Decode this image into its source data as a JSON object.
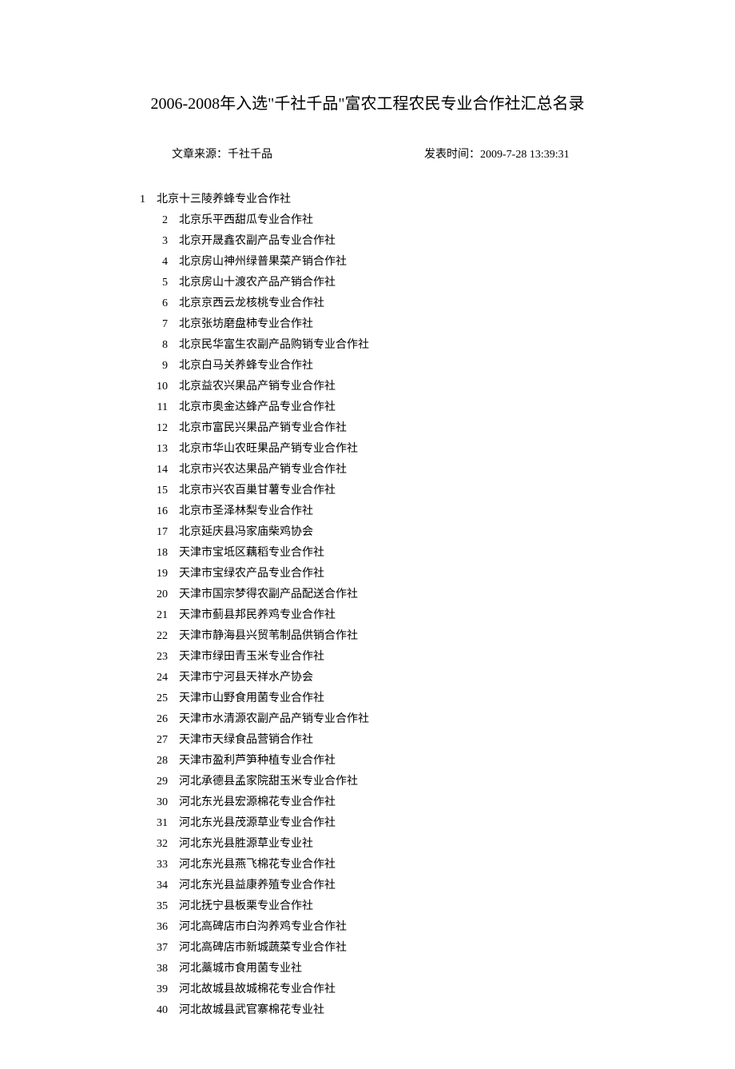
{
  "title": "2006-2008年入选\"千社千品\"富农工程农民专业合作社汇总名录",
  "source_label": "文章来源：千社千品",
  "publish_label": "发表时间：2009-7-28 13:39:31",
  "items": [
    {
      "n": "1",
      "name": "北京十三陵养蜂专业合作社"
    },
    {
      "n": "2",
      "name": "北京乐平西甜瓜专业合作社"
    },
    {
      "n": "3",
      "name": "北京开晟鑫农副产品专业合作社"
    },
    {
      "n": "4",
      "name": "北京房山神州绿普果菜产销合作社"
    },
    {
      "n": "5",
      "name": "北京房山十渡农产品产销合作社"
    },
    {
      "n": "6",
      "name": "北京京西云龙核桃专业合作社"
    },
    {
      "n": "7",
      "name": "北京张坊磨盘柿专业合作社"
    },
    {
      "n": "8",
      "name": "北京民华富生农副产品购销专业合作社"
    },
    {
      "n": "9",
      "name": "北京白马关养蜂专业合作社"
    },
    {
      "n": "10",
      "name": "北京益农兴果品产销专业合作社"
    },
    {
      "n": "11",
      "name": "北京市奥金达蜂产品专业合作社"
    },
    {
      "n": "12",
      "name": "北京市富民兴果品产销专业合作社"
    },
    {
      "n": "13",
      "name": "北京市华山农旺果品产销专业合作社"
    },
    {
      "n": "14",
      "name": "北京市兴农达果品产销专业合作社"
    },
    {
      "n": "15",
      "name": "北京市兴农百巢甘薯专业合作社"
    },
    {
      "n": "16",
      "name": "北京市圣泽林梨专业合作社"
    },
    {
      "n": "17",
      "name": "北京延庆县冯家庙柴鸡协会"
    },
    {
      "n": "18",
      "name": "天津市宝坻区藕稻专业合作社"
    },
    {
      "n": "19",
      "name": "天津市宝绿农产品专业合作社"
    },
    {
      "n": "20",
      "name": "天津市国宗梦得农副产品配送合作社"
    },
    {
      "n": "21",
      "name": "天津市蓟县邦民养鸡专业合作社"
    },
    {
      "n": "22",
      "name": "天津市静海县兴贸苇制品供销合作社"
    },
    {
      "n": "23",
      "name": "天津市绿田青玉米专业合作社"
    },
    {
      "n": "24",
      "name": "天津市宁河县天祥水产协会"
    },
    {
      "n": "25",
      "name": "天津市山野食用菌专业合作社"
    },
    {
      "n": "26",
      "name": "天津市水清源农副产品产销专业合作社"
    },
    {
      "n": "27",
      "name": "天津市天绿食品营销合作社"
    },
    {
      "n": "28",
      "name": "天津市盈利芦笋种植专业合作社"
    },
    {
      "n": "29",
      "name": "河北承德县孟家院甜玉米专业合作社"
    },
    {
      "n": "30",
      "name": "河北东光县宏源棉花专业合作社"
    },
    {
      "n": "31",
      "name": "河北东光县茂源草业专业合作社"
    },
    {
      "n": "32",
      "name": "河北东光县胜源草业专业社"
    },
    {
      "n": "33",
      "name": "河北东光县燕飞棉花专业合作社"
    },
    {
      "n": "34",
      "name": "河北东光县益康养殖专业合作社"
    },
    {
      "n": "35",
      "name": "河北抚宁县板栗专业合作社"
    },
    {
      "n": "36",
      "name": "河北高碑店市白沟养鸡专业合作社"
    },
    {
      "n": "37",
      "name": "河北高碑店市新城蔬菜专业合作社"
    },
    {
      "n": "38",
      "name": "河北藁城市食用菌专业社"
    },
    {
      "n": "39",
      "name": "河北故城县故城棉花专业合作社"
    },
    {
      "n": "40",
      "name": "河北故城县武官寨棉花专业社"
    }
  ]
}
